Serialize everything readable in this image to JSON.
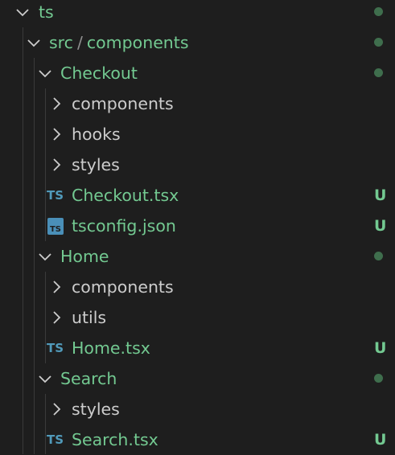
{
  "explorer": {
    "root": {
      "label": "ts"
    },
    "src_components": {
      "label_a": "src",
      "separator": "/",
      "label_b": "components"
    },
    "checkout": {
      "label": "Checkout",
      "children": {
        "components": "components",
        "hooks": "hooks",
        "styles": "styles",
        "file_tsx": {
          "name": "Checkout.tsx",
          "icon_text": "TS",
          "status": "U"
        },
        "file_json": {
          "name": "tsconfig.json",
          "icon_text": "TS",
          "status": "U"
        }
      }
    },
    "home": {
      "label": "Home",
      "children": {
        "components": "components",
        "utils": "utils",
        "file_tsx": {
          "name": "Home.tsx",
          "icon_text": "TS",
          "status": "U"
        }
      }
    },
    "search": {
      "label": "Search",
      "children": {
        "styles": "styles",
        "file_tsx": {
          "name": "Search.tsx",
          "icon_text": "TS",
          "status": "U"
        }
      }
    }
  },
  "colors": {
    "background": "#1e1e1e",
    "modified_text": "#73c991",
    "default_text": "#cccccc",
    "modified_dot": "#3f6e4d",
    "ts_icon": "#519aba",
    "indent_guide": "#3a3a3a"
  },
  "icons": {
    "expanded": "chevron-down-icon",
    "collapsed": "chevron-right-icon",
    "typescript": "typescript-file-icon",
    "tsconfig": "tsconfig-file-icon"
  }
}
